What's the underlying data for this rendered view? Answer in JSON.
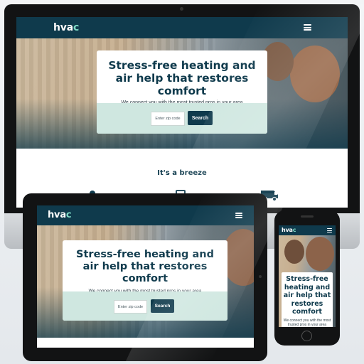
{
  "site": {
    "logo_text": "hva",
    "logo_accent": "c",
    "headline": "Stress-free heating and air help that restores comfort",
    "subtext": "We connect you with the most trusted pros in your area",
    "zip_placeholder": "Enter zip code",
    "search_label": "Search",
    "section_title": "It's a breeze"
  },
  "colors": {
    "brand_navy": "#0f3a4c",
    "accent_mint": "#cfe7e0",
    "logo_accent": "#7ed9c5"
  },
  "icons": [
    "menu-icon",
    "person-icon",
    "thermostat-icon",
    "van-icon"
  ]
}
